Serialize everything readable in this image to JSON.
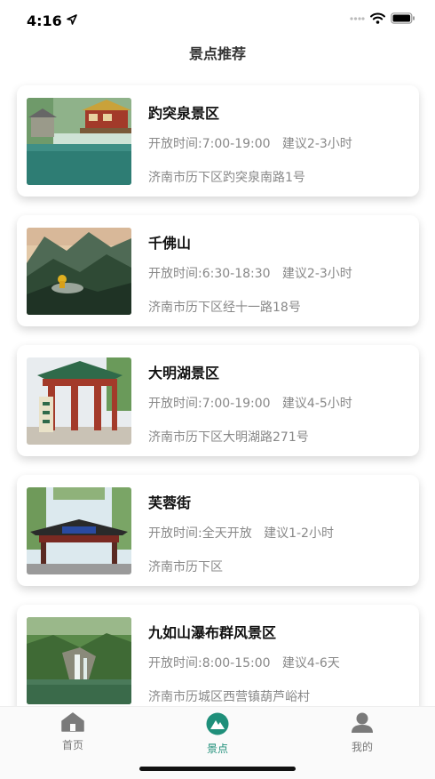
{
  "status": {
    "time": "4:16"
  },
  "page": {
    "title": "景点推荐"
  },
  "spots": [
    {
      "name": "趵突泉景区",
      "hours": "开放时间:7:00-19:00",
      "suggest": "建议2-3小时",
      "address": "济南市历下区趵突泉南路1号",
      "image": "spring-pavilion"
    },
    {
      "name": "千佛山",
      "hours": "开放时间:6:30-18:30",
      "suggest": "建议2-3小时",
      "address": "济南市历下区经十一路18号",
      "image": "mountain-buddha"
    },
    {
      "name": "大明湖景区",
      "hours": "开放时间:7:00-19:00",
      "suggest": "建议4-5小时",
      "address": "济南市历下区大明湖路271号",
      "image": "lake-archway"
    },
    {
      "name": "芙蓉街",
      "hours": "开放时间:全天开放",
      "suggest": "建议1-2小时",
      "address": "济南市历下区",
      "image": "street-archway"
    },
    {
      "name": "九如山瀑布群风景区",
      "hours": "开放时间:8:00-15:00",
      "suggest": "建议4-6天",
      "address": "济南市历城区西营镇葫芦峪村",
      "image": "waterfall"
    }
  ],
  "tabs": [
    {
      "label": "首页",
      "icon": "home-icon"
    },
    {
      "label": "景点",
      "icon": "mountain-icon"
    },
    {
      "label": "我的",
      "icon": "person-icon"
    }
  ],
  "colors": {
    "accent": "#1f8f7a",
    "muted": "#888888"
  }
}
